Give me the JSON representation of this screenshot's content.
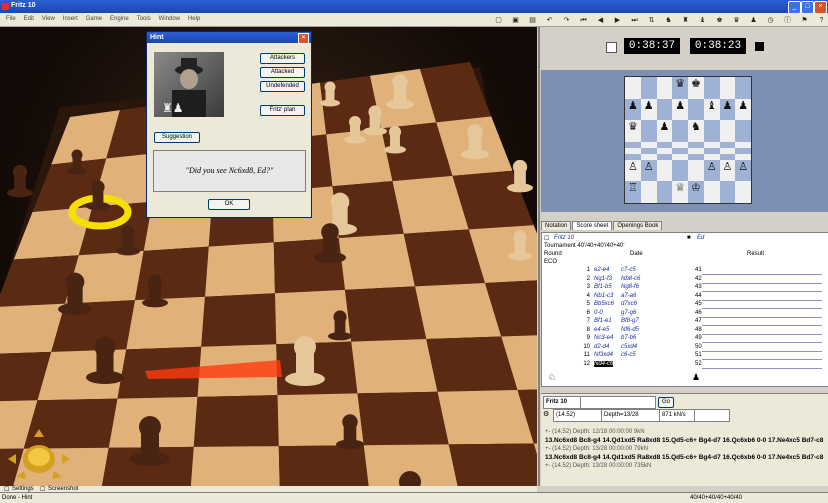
{
  "window": {
    "title": "Fritz 10"
  },
  "menu": [
    "File",
    "Edit",
    "View",
    "Insert",
    "Game",
    "Engine",
    "Tools",
    "Window",
    "Help"
  ],
  "hint_dialog": {
    "title": "Hint",
    "buttons": {
      "attackers": "Attackers",
      "attacked": "Attacked",
      "undefended": "Undefended",
      "fritz_plan": "Fritz' plan",
      "suggestion": "Suggestion",
      "ok": "OK"
    },
    "quote": "\"Did you see Nc6xd8, Ed?\""
  },
  "clocks": {
    "white": "0:38:37",
    "black": "0:38:23"
  },
  "mini_board": [
    [
      "",
      "",
      "",
      "♛",
      "♚",
      "",
      "",
      ""
    ],
    [
      "♟",
      "♟",
      "",
      "♟",
      "",
      "♝",
      "♟",
      "♟"
    ],
    [
      "♛",
      "",
      "♟",
      "",
      "♞",
      "",
      "",
      ""
    ],
    [
      "",
      "",
      "",
      "",
      "",
      "",
      "",
      ""
    ],
    [
      "",
      "",
      "",
      "",
      "",
      "",
      "",
      ""
    ],
    [
      "",
      "",
      "",
      "",
      "",
      "",
      "",
      ""
    ],
    [
      "♙",
      "♙",
      "",
      "",
      "",
      "♙",
      "♙",
      "♙"
    ],
    [
      "♖",
      "",
      "",
      "♕",
      "♔",
      "",
      "",
      ""
    ]
  ],
  "tabs": {
    "notation": "Notation",
    "score_sheet": "Score sheet",
    "openings": "Openings Book"
  },
  "score": {
    "white_player": "Fritz 10",
    "black_player": "Ed",
    "tournament": "Tournament 40'/40+40'/40+40'",
    "round_label": "Round",
    "date_label": "Date",
    "result_label": "Result",
    "eco_label": "ECO",
    "moves": [
      {
        "n": "1",
        "w": "e2-e4",
        "b": "c7-c5",
        "r": "41"
      },
      {
        "n": "2",
        "w": "Ng1-f3",
        "b": "Nb8-c6",
        "r": "42"
      },
      {
        "n": "3",
        "w": "Bf1-b5",
        "b": "Ng8-f6",
        "r": "43"
      },
      {
        "n": "4",
        "w": "Nb1-c3",
        "b": "a7-a6",
        "r": "44"
      },
      {
        "n": "5",
        "w": "Bb5xc6",
        "b": "d7xc6",
        "r": "45"
      },
      {
        "n": "6",
        "w": "0-0",
        "b": "g7-g6",
        "r": "46"
      },
      {
        "n": "7",
        "w": "Bf1-e1",
        "b": "Bf8-g7",
        "r": "47"
      },
      {
        "n": "8",
        "w": "e4-e5",
        "b": "Nf6-d5",
        "r": "48"
      },
      {
        "n": "9",
        "w": "Nc3-e4",
        "b": "b7-b6",
        "r": "49"
      },
      {
        "n": "10",
        "w": "d2-d4",
        "b": "c5xd4",
        "r": "50"
      },
      {
        "n": "11",
        "w": "Nf3xd4",
        "b": "c6-c5",
        "r": "51"
      },
      {
        "n": "12",
        "w": "Nd4-c6",
        "b": "",
        "r": "52"
      }
    ]
  },
  "engine": {
    "name": "Fritz 10",
    "go": "Go",
    "eval": "(14.52)",
    "depth": "Depth=13/28",
    "speed": "871 kN/s",
    "lines": [
      "+-  (14.52)   Depth: 12/18   00:00:00  9kN",
      "13.Nc6xd8 Bc8-g4 14.Qd1xd5 Ra8xd8 15.Qd5-c6+ Bg4-d7 16.Qc6xb6 0-0 17.Ne4xc5 Bd7-c8",
      "+-  (14.52)   Depth: 13/28   00:00:00  79kN",
      "13.Nc6xd8 Bc8-g4 14.Qd1xd5 Ra8xd8 15.Qd5-c6+ Bg4-d7 16.Qc6xb6 0-0 17.Ne4xc5 Bd7-c8",
      "+-  (14.52)   Depth: 13/28   00:00:00  735kN"
    ]
  },
  "bottom": {
    "settings": "Settings",
    "screenshot": "Screenshot"
  },
  "status": {
    "left": "Done - Hint",
    "right": "40/40+40/40+40/40"
  }
}
